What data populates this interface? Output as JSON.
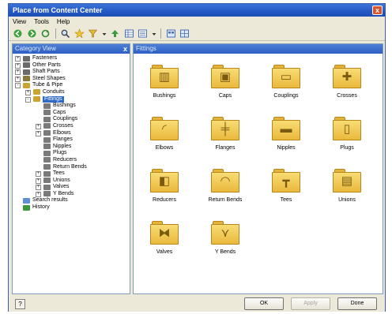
{
  "window": {
    "title": "Place from Content Center",
    "close_glyph": "x"
  },
  "menu": [
    "View",
    "Tools",
    "Help"
  ],
  "toolbar": {
    "icons": [
      "back-icon",
      "forward-icon",
      "refresh-icon",
      "search-icon",
      "favorites-icon",
      "filter-icon",
      "table-view-icon",
      "list-view-icon",
      "details-view-icon"
    ]
  },
  "category_view": {
    "header": "Category View",
    "close_glyph": "x",
    "tree": [
      {
        "label": "Fasteners",
        "depth": 0,
        "expander": "+",
        "icon_color": "#6b6b6b"
      },
      {
        "label": "Other Parts",
        "depth": 0,
        "expander": "+",
        "icon_color": "#6b6b6b"
      },
      {
        "label": "Shaft Parts",
        "depth": 0,
        "expander": "+",
        "icon_color": "#6b6b6b"
      },
      {
        "label": "Steel Shapes",
        "depth": 0,
        "expander": "+",
        "icon_color": "#8a7a3a"
      },
      {
        "label": "Tube & Pipe",
        "depth": 0,
        "expander": "-",
        "icon_color": "#c9a430"
      },
      {
        "label": "Conduits",
        "depth": 1,
        "expander": "+",
        "icon_color": "#c9a430"
      },
      {
        "label": "Fittings",
        "depth": 1,
        "expander": "-",
        "icon_color": "#c9a430",
        "selected": true
      },
      {
        "label": "Bushings",
        "depth": 2,
        "expander": "",
        "icon_color": "#7a7a7a"
      },
      {
        "label": "Caps",
        "depth": 2,
        "expander": "",
        "icon_color": "#7a7a7a"
      },
      {
        "label": "Couplings",
        "depth": 2,
        "expander": "",
        "icon_color": "#7a7a7a"
      },
      {
        "label": "Crosses",
        "depth": 2,
        "expander": "+",
        "icon_color": "#7a7a7a"
      },
      {
        "label": "Elbows",
        "depth": 2,
        "expander": "+",
        "icon_color": "#7a7a7a"
      },
      {
        "label": "Flanges",
        "depth": 2,
        "expander": "",
        "icon_color": "#7a7a7a"
      },
      {
        "label": "Nipples",
        "depth": 2,
        "expander": "",
        "icon_color": "#7a7a7a"
      },
      {
        "label": "Plugs",
        "depth": 2,
        "expander": "",
        "icon_color": "#7a7a7a"
      },
      {
        "label": "Reducers",
        "depth": 2,
        "expander": "",
        "icon_color": "#7a7a7a"
      },
      {
        "label": "Return Bends",
        "depth": 2,
        "expander": "",
        "icon_color": "#7a7a7a"
      },
      {
        "label": "Tees",
        "depth": 2,
        "expander": "+",
        "icon_color": "#7a7a7a"
      },
      {
        "label": "Unions",
        "depth": 2,
        "expander": "+",
        "icon_color": "#7a7a7a"
      },
      {
        "label": "Valves",
        "depth": 2,
        "expander": "+",
        "icon_color": "#7a7a7a"
      },
      {
        "label": "Y Bends",
        "depth": 2,
        "expander": "+",
        "icon_color": "#7a7a7a"
      },
      {
        "label": "Search results",
        "depth": 0,
        "expander": "",
        "icon_color": "#5b8fd6"
      },
      {
        "label": "History",
        "depth": 0,
        "expander": "",
        "icon_color": "#3a9a3a"
      }
    ]
  },
  "content": {
    "header": "Fittings",
    "items": [
      {
        "label": "Bushings",
        "icon": "bushing-icon",
        "symbol": "▥"
      },
      {
        "label": "Caps",
        "icon": "cap-icon",
        "symbol": "▣"
      },
      {
        "label": "Couplings",
        "icon": "coupling-icon",
        "symbol": "▭"
      },
      {
        "label": "Crosses",
        "icon": "cross-icon",
        "symbol": "✚"
      },
      {
        "label": "Elbows",
        "icon": "elbow-icon",
        "symbol": "◜"
      },
      {
        "label": "Flanges",
        "icon": "flange-icon",
        "symbol": "╪"
      },
      {
        "label": "Nipples",
        "icon": "nipple-icon",
        "symbol": "▬"
      },
      {
        "label": "Plugs",
        "icon": "plug-icon",
        "symbol": "▯"
      },
      {
        "label": "Reducers",
        "icon": "reducer-icon",
        "symbol": "◧"
      },
      {
        "label": "Return Bends",
        "icon": "return-bend-icon",
        "symbol": "◠"
      },
      {
        "label": "Tees",
        "icon": "tee-icon",
        "symbol": "┳"
      },
      {
        "label": "Unions",
        "icon": "union-icon",
        "symbol": "▤"
      },
      {
        "label": "Valves",
        "icon": "valve-icon",
        "symbol": "⧓"
      },
      {
        "label": "Y Bends",
        "icon": "y-bend-icon",
        "symbol": "⋎"
      }
    ]
  },
  "buttons": {
    "ok": "OK",
    "apply": "Apply",
    "done": "Done"
  },
  "status_icon_glyph": "?"
}
